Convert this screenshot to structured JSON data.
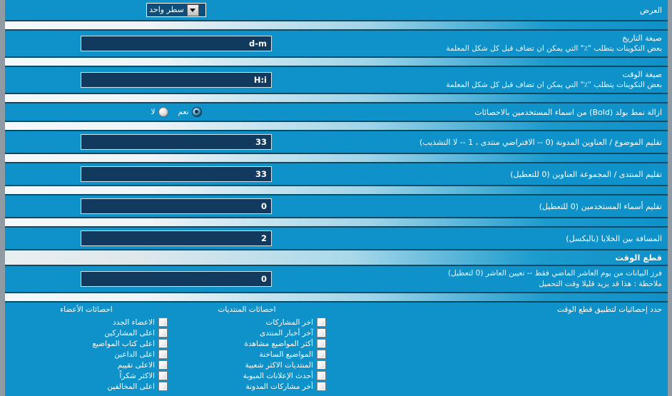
{
  "theme": {
    "panel_bg": "#0f91c9",
    "input_bg": "#123a5e",
    "border": "#0a4f6e",
    "outer_bg": "#8f9aa3",
    "text": "#ffffff"
  },
  "rows": {
    "display": {
      "title": "العرض",
      "select": {
        "value": "سطر واحد",
        "options": [
          "سطر واحد"
        ]
      }
    },
    "date_format": {
      "title": "صيغة التاريخ",
      "desc": "بعض التكوينات يتطلب \"٪\" التي يمكن ان تضاف قبل كل شكل المعلمة",
      "value": "d-m"
    },
    "time_format": {
      "title": "صيغة الوقت",
      "desc": "بعض التكوينات يتطلب \"٪\" التي يمكن ان تضاف قبل كل شكل المعلمة",
      "value": "H:i"
    },
    "remove_bold": {
      "title": "ازالة نمط بولد (Bold) من اسماء المستخدمين بالاحصائات",
      "radios": [
        {
          "label": "نعم",
          "selected": true
        },
        {
          "label": "لا",
          "selected": false
        }
      ]
    },
    "trim_topic": {
      "title": "تقليم الموضوع / العناوين المدونة (0 -- الافتراضي منتدى ، 1 -- لا التشذيب)",
      "value": "33"
    },
    "trim_forum": {
      "title": "تقليم المنتدى / المجموعة العناوين (0 للتعطيل)",
      "value": "33"
    },
    "trim_usernames": {
      "title": "تقليم أسماء المستخدمين (0 للتعطيل)",
      "value": "0"
    },
    "cell_spacing": {
      "title": "المسافة بين الخلايا (بالبكسل)",
      "value": "2"
    }
  },
  "timecut": {
    "header": "قطع الوقت",
    "desc_line1": "فرز البيانات من يوم العاشر الماضي فقط -- تعيين العاشر (0 لتعطيل)",
    "desc_line2": "ملاحظة : هذا قد يزيد قليلا وقت التحميل",
    "value": "0",
    "instruction": "حدد إحصائيات لتطبيق قطع الوقت",
    "columns": [
      {
        "heading": "احصائات المنتديات",
        "items": [
          {
            "label": "اخر المشاركات",
            "checked": false
          },
          {
            "label": "آخر أخبار المنتدى",
            "checked": false
          },
          {
            "label": "أكثر المواضيع مشاهدة",
            "checked": false
          },
          {
            "label": "المواضيع الساخنة",
            "checked": false
          },
          {
            "label": "المنتديات الاكثر شعبية",
            "checked": false
          },
          {
            "label": "أحدث الإعلانات المبوبة",
            "checked": false
          },
          {
            "label": "أخر مشاركات المدونة",
            "checked": false
          }
        ]
      },
      {
        "heading": "احصائات الأعضاء",
        "items": [
          {
            "label": "الاعضاء الجدد",
            "checked": false
          },
          {
            "label": "اعلى المشاركين",
            "checked": false
          },
          {
            "label": "اعلى كتاب المواضيع",
            "checked": false
          },
          {
            "label": "اعلى الداعين",
            "checked": false
          },
          {
            "label": "الاعلى تقييم",
            "checked": false
          },
          {
            "label": "الاكثر شكراً",
            "checked": false
          },
          {
            "label": "اعلى المخالفين",
            "checked": false
          }
        ]
      }
    ]
  }
}
